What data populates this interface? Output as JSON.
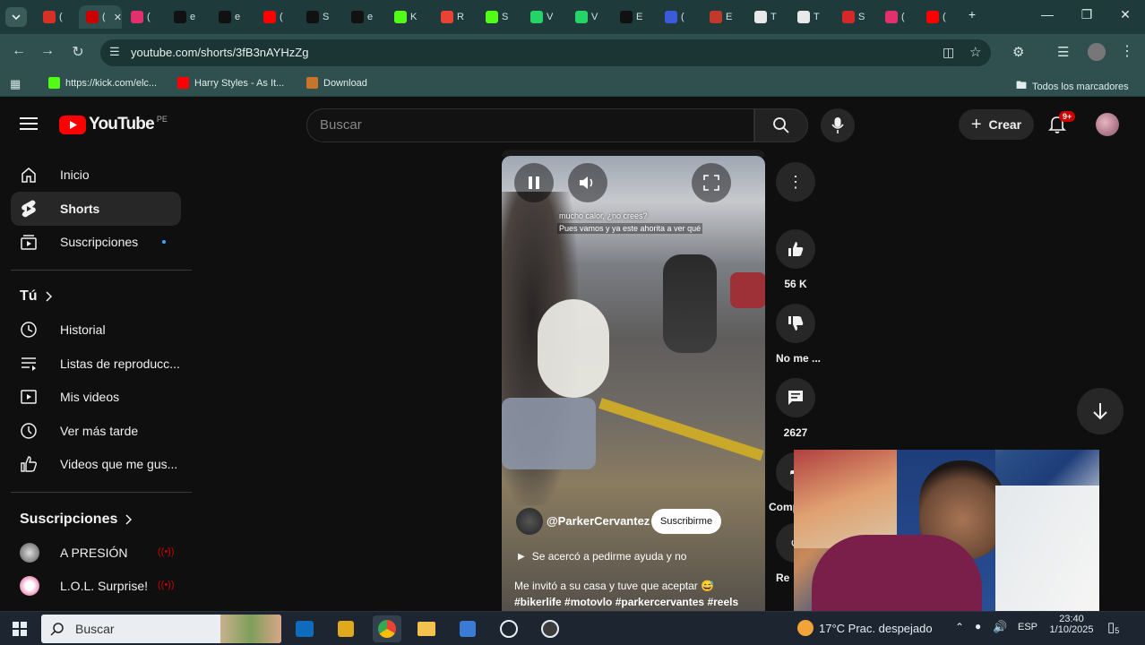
{
  "browser": {
    "tabs": [
      {
        "label": "(",
        "fav": "#d93025"
      },
      {
        "label": "(",
        "fav": "#cc0000"
      },
      {
        "label": "(",
        "fav": "#e1306c"
      },
      {
        "label": "e",
        "fav": "#111111"
      },
      {
        "label": "e",
        "fav": "#111111"
      },
      {
        "label": "(",
        "fav": "#ff0000"
      },
      {
        "label": "S",
        "fav": "#111111"
      },
      {
        "label": "e",
        "fav": "#111111"
      },
      {
        "label": "K",
        "fav": "#53fc18"
      },
      {
        "label": "R",
        "fav": "#ea4335"
      },
      {
        "label": "S",
        "fav": "#53fc18"
      },
      {
        "label": "V",
        "fav": "#25d366"
      },
      {
        "label": "V",
        "fav": "#25d366"
      },
      {
        "label": "E",
        "fav": "#111111"
      },
      {
        "label": "(",
        "fav": "#3b5bdb"
      },
      {
        "label": "E",
        "fav": "#c0392b"
      },
      {
        "label": "T",
        "fav": "#e8e8e8"
      },
      {
        "label": "T",
        "fav": "#e8e8e8"
      },
      {
        "label": "S",
        "fav": "#d62828"
      },
      {
        "label": "(",
        "fav": "#e1306c"
      },
      {
        "label": "(",
        "fav": "#ff0000"
      }
    ],
    "url": "youtube.com/shorts/3fB3nAYHzZg",
    "bookmarks": [
      {
        "label": "https://kick.com/elc...",
        "fav": "#53fc18"
      },
      {
        "label": "Harry Styles - As It...",
        "fav": "#ff0000"
      },
      {
        "label": "Download",
        "fav": "#c9742b"
      }
    ],
    "all_bookmarks": "Todos los marcadores"
  },
  "youtube": {
    "logo_text": "YouTube",
    "region": "PE",
    "search_placeholder": "Buscar",
    "create_label": "Crear",
    "notif_count": "9+"
  },
  "sidebar": {
    "main": [
      {
        "label": "Inicio",
        "icon": "home-icon"
      },
      {
        "label": "Shorts",
        "icon": "shorts-icon"
      },
      {
        "label": "Suscripciones",
        "icon": "subscriptions-icon"
      }
    ],
    "you_heading": "Tú",
    "you": [
      {
        "label": "Historial",
        "icon": "history-icon"
      },
      {
        "label": "Listas de reproducc...",
        "icon": "playlists-icon"
      },
      {
        "label": "Mis videos",
        "icon": "my-videos-icon"
      },
      {
        "label": "Ver más tarde",
        "icon": "watch-later-icon"
      },
      {
        "label": "Videos que me gus...",
        "icon": "liked-icon"
      }
    ],
    "subs_heading": "Suscripciones",
    "subs": [
      {
        "label": "A PRESIÓN"
      },
      {
        "label": "L.O.L. Surprise!"
      }
    ]
  },
  "short": {
    "overlay_line1": "mucho calor, ¿no crees?",
    "overlay_line2": "Pues vamos y ya este ahorita a ver qué",
    "channel": "@ParkerCervantez",
    "subscribe": "Suscribirme",
    "song": "Se acercó a pedirme ayuda y no",
    "description": "Me invitó a su casa y tuve que aceptar 😅",
    "hashtags": "#bikerlife #motovlo #parkercervantes #reels",
    "likes": "56 K",
    "dislike": "No me ...",
    "comments": "2627",
    "share": "Comp",
    "remix": "Re"
  },
  "taskbar": {
    "search_placeholder": "Buscar",
    "weather": "17°C  Prac. despejado",
    "lang": "ESP",
    "time": "23:40",
    "date": "1/10/2025",
    "notif": "5"
  }
}
